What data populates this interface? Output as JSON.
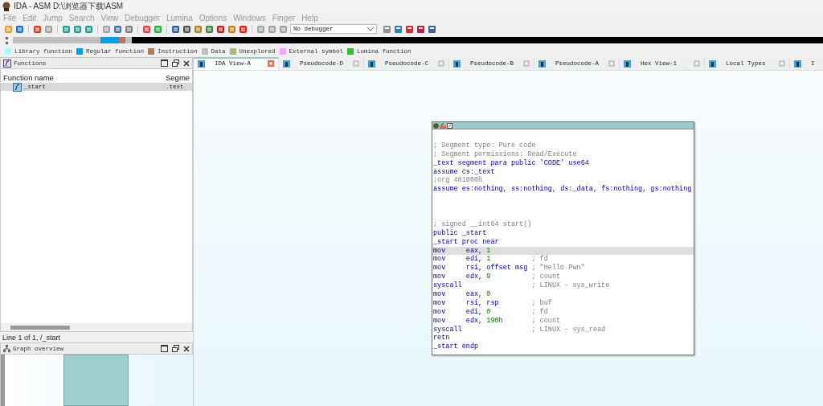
{
  "window": {
    "title": "IDA - ASM D:\\浏览器下载\\ASM"
  },
  "menu": [
    "File",
    "Edit",
    "Jump",
    "Search",
    "View",
    "Debugger",
    "Lumina",
    "Options",
    "Windows",
    "Finger",
    "Help"
  ],
  "debugger_select": {
    "value": "No debugger"
  },
  "legend": [
    {
      "label": "Library function",
      "color": "#a0ffff"
    },
    {
      "label": "Regular function",
      "color": "#00a0e8"
    },
    {
      "label": "Instruction",
      "color": "#b4785a"
    },
    {
      "label": "Data",
      "color": "#c0c0c0"
    },
    {
      "label": "Unexplored",
      "color": "#b4b46e"
    },
    {
      "label": "External symbol",
      "color": "#ffa0ff"
    },
    {
      "label": "Lumina function",
      "color": "#30c030"
    }
  ],
  "functions_panel": {
    "title": "Functions",
    "columns": [
      "Function name",
      "Segme"
    ],
    "rows": [
      {
        "name": "_start",
        "segment": ".text",
        "selected": true
      }
    ],
    "status": "Line 1 of 1, /_start"
  },
  "graph_overview": {
    "title": "Graph overview"
  },
  "tabs": [
    {
      "label": "IDA View-A",
      "selected": true
    },
    {
      "label": "Pseudocode-D",
      "selected": false
    },
    {
      "label": "Pseudocode-C",
      "selected": false
    },
    {
      "label": "Pseudocode-B",
      "selected": false
    },
    {
      "label": "Pseudocode-A",
      "selected": false
    },
    {
      "label": "Hex View-1",
      "selected": false
    },
    {
      "label": "Local Types",
      "selected": false
    },
    {
      "label": "I",
      "selected": false
    }
  ],
  "code_lines": [
    {
      "kind": "blank"
    },
    {
      "kind": "comment",
      "text": "; Segment type: Pure code"
    },
    {
      "kind": "comment",
      "text": "; Segment permissions: Read/Execute"
    },
    {
      "kind": "directive",
      "text": "_text segment para public 'CODE' use64"
    },
    {
      "kind": "directive",
      "text": "assume cs:_text"
    },
    {
      "kind": "comment",
      "text": ";org 401000h"
    },
    {
      "kind": "directive",
      "text": "assume es:nothing, ss:nothing, ds:_data, fs:nothing, gs:nothing"
    },
    {
      "kind": "blank"
    },
    {
      "kind": "blank"
    },
    {
      "kind": "blank"
    },
    {
      "kind": "comment",
      "text": "; signed __int64 start()"
    },
    {
      "kind": "directive",
      "text": "public _start"
    },
    {
      "kind": "directive",
      "text": "_start proc near"
    },
    {
      "kind": "instruction",
      "mnemonic": "mov",
      "operands": [
        {
          "text": "eax, ",
          "kind": "reg"
        },
        {
          "text": "1",
          "kind": "number"
        }
      ],
      "selected": true
    },
    {
      "kind": "instruction",
      "mnemonic": "mov",
      "operands": [
        {
          "text": "edi, ",
          "kind": "reg"
        },
        {
          "text": "1",
          "kind": "number"
        }
      ],
      "comment": "; fd",
      "selected": false
    },
    {
      "kind": "instruction",
      "mnemonic": "mov",
      "operands": [
        {
          "text": "rsi, offset msg",
          "kind": "reg"
        }
      ],
      "comment": "; \"Hello Pwn\"",
      "selected": false
    },
    {
      "kind": "instruction",
      "mnemonic": "mov",
      "operands": [
        {
          "text": "edx, ",
          "kind": "reg"
        },
        {
          "text": "9",
          "kind": "number"
        }
      ],
      "comment": "; count",
      "selected": false
    },
    {
      "kind": "instruction",
      "mnemonic": "syscall",
      "comment": "; LINUX - sys_write",
      "selected": false
    },
    {
      "kind": "instruction",
      "mnemonic": "mov",
      "operands": [
        {
          "text": "eax, ",
          "kind": "reg"
        },
        {
          "text": "0",
          "kind": "number"
        }
      ],
      "selected": false
    },
    {
      "kind": "instruction",
      "mnemonic": "mov",
      "operands": [
        {
          "text": "rsi, rsp",
          "kind": "reg"
        }
      ],
      "comment": "; buf",
      "selected": false
    },
    {
      "kind": "instruction",
      "mnemonic": "mov",
      "operands": [
        {
          "text": "edi, ",
          "kind": "reg"
        },
        {
          "text": "0",
          "kind": "number"
        }
      ],
      "comment": "; fd",
      "selected": false
    },
    {
      "kind": "instruction",
      "mnemonic": "mov",
      "operands": [
        {
          "text": "edx, ",
          "kind": "reg"
        },
        {
          "text": "190h",
          "kind": "number"
        }
      ],
      "comment": "; count",
      "selected": false
    },
    {
      "kind": "instruction",
      "mnemonic": "syscall",
      "comment": "; LINUX - sys_read",
      "selected": false
    },
    {
      "kind": "instruction",
      "mnemonic": "retn",
      "selected": false
    },
    {
      "kind": "directive",
      "text": "_start endp"
    }
  ]
}
